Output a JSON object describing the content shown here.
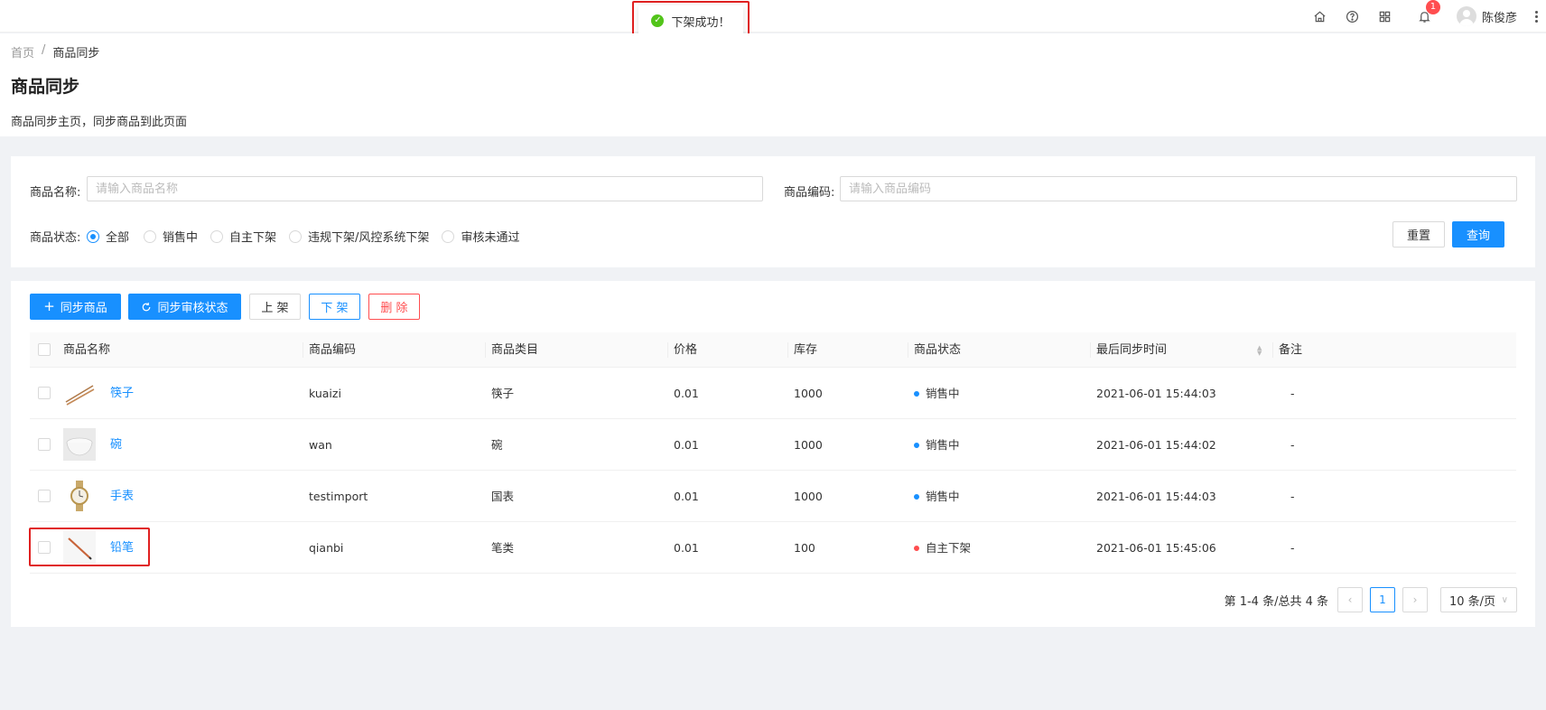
{
  "header": {
    "username": "陈俊彦",
    "notification_count": "1"
  },
  "toast": {
    "message": "下架成功！"
  },
  "breadcrumb": {
    "home": "首页",
    "separator": "/",
    "current": "商品同步"
  },
  "page": {
    "title": "商品同步",
    "description": "商品同步主页，同步商品到此页面"
  },
  "search": {
    "name_label": "商品名称:",
    "name_placeholder": "请输入商品名称",
    "code_label": "商品编码:",
    "code_placeholder": "请输入商品编码",
    "status_label": "商品状态:",
    "status_options": [
      "全部",
      "销售中",
      "自主下架",
      "违规下架/风控系统下架",
      "审核未通过"
    ],
    "selected_status": "全部",
    "reset_label": "重置",
    "query_label": "查询"
  },
  "toolbar": {
    "sync_goods": "同步商品",
    "sync_audit": "同步审核状态",
    "list_up": "上 架",
    "list_down": "下 架",
    "delete": "删 除"
  },
  "table": {
    "columns": [
      "商品名称",
      "商品编码",
      "商品类目",
      "价格",
      "库存",
      "商品状态",
      "最后同步时间",
      "备注"
    ],
    "rows": [
      {
        "name": "筷子",
        "code": "kuaizi",
        "category": "筷子",
        "price": "0.01",
        "stock": "1000",
        "status": "销售中",
        "status_color": "#1890ff",
        "sync_time": "2021-06-01 15:44:03",
        "remark": "-"
      },
      {
        "name": "碗",
        "code": "wan",
        "category": "碗",
        "price": "0.01",
        "stock": "1000",
        "status": "销售中",
        "status_color": "#1890ff",
        "sync_time": "2021-06-01 15:44:02",
        "remark": "-"
      },
      {
        "name": "手表",
        "code": "testimport",
        "category": "国表",
        "price": "0.01",
        "stock": "1000",
        "status": "销售中",
        "status_color": "#1890ff",
        "sync_time": "2021-06-01 15:44:03",
        "remark": "-"
      },
      {
        "name": "铅笔",
        "code": "qianbi",
        "category": "笔类",
        "price": "0.01",
        "stock": "100",
        "status": "自主下架",
        "status_color": "#ff4d4f",
        "sync_time": "2021-06-01 15:45:06",
        "remark": "-"
      }
    ]
  },
  "pagination": {
    "total_text": "第 1-4 条/总共 4 条",
    "current_page": "1",
    "page_size": "10 条/页"
  }
}
